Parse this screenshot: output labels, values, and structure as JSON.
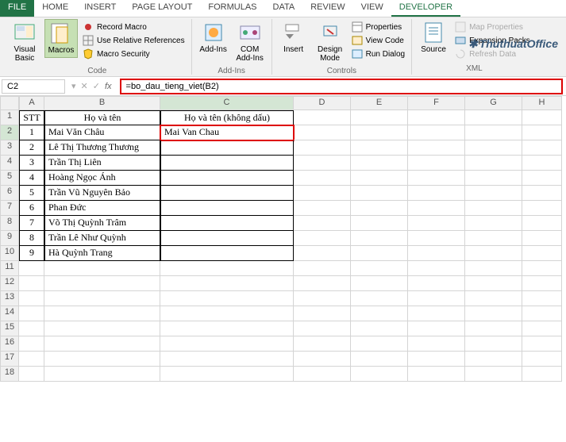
{
  "menu": {
    "file": "FILE",
    "home": "HOME",
    "insert": "INSERT",
    "pagelayout": "PAGE LAYOUT",
    "formulas": "FORMULAS",
    "data": "DATA",
    "review": "REVIEW",
    "view": "VIEW",
    "developer": "DEVELOPER"
  },
  "ribbon": {
    "code": {
      "label": "Code",
      "visual_basic": "Visual\nBasic",
      "macros": "Macros",
      "record": "Record Macro",
      "useref": "Use Relative References",
      "macrosec": "Macro Security"
    },
    "addins": {
      "label": "Add-Ins",
      "addins": "Add-Ins",
      "com": "COM\nAdd-Ins"
    },
    "controls": {
      "label": "Controls",
      "insert": "Insert",
      "design": "Design\nMode",
      "props": "Properties",
      "viewcode": "View Code",
      "rundialog": "Run Dialog"
    },
    "xml": {
      "label": "XML",
      "source": "Source",
      "mapprops": "Map Properties",
      "expansion": "Expansion Packs",
      "refresh": "Refresh Data"
    }
  },
  "namebox": "C2",
  "formula": "=bo_dau_tieng_viet(B2)",
  "watermark": "ThuthuatOffice",
  "cols": {
    "A": 32,
    "B": 146,
    "C": 168,
    "D": 72,
    "E": 72,
    "F": 72,
    "G": 72,
    "H": 50
  },
  "headers": {
    "A": "STT",
    "B": "Họ và tên",
    "C": "Họ và tên (không dấu)"
  },
  "rows": [
    {
      "stt": "1",
      "name": "Mai Văn Châu",
      "result": "Mai Van Chau"
    },
    {
      "stt": "2",
      "name": "Lê Thị Thương Thương",
      "result": ""
    },
    {
      "stt": "3",
      "name": "Trần Thị Liên",
      "result": ""
    },
    {
      "stt": "4",
      "name": "Hoàng Ngọc Ánh",
      "result": ""
    },
    {
      "stt": "5",
      "name": "Trần Vũ Nguyên Bảo",
      "result": ""
    },
    {
      "stt": "6",
      "name": "Phan Đức",
      "result": ""
    },
    {
      "stt": "7",
      "name": "Võ Thị Quỳnh Trâm",
      "result": ""
    },
    {
      "stt": "8",
      "name": "Trần Lê Như Quỳnh",
      "result": ""
    },
    {
      "stt": "9",
      "name": "Hà Quỳnh Trang",
      "result": ""
    }
  ],
  "emptyRows": 8
}
